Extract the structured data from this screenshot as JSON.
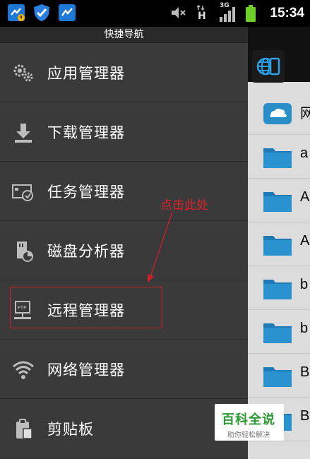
{
  "status_bar": {
    "time": "15:34",
    "network_label": "3G",
    "signal_label": "H"
  },
  "drawer": {
    "title": "快捷导航",
    "items": [
      {
        "label": "应用管理器",
        "icon": "gears-icon"
      },
      {
        "label": "下载管理器",
        "icon": "download-icon"
      },
      {
        "label": "任务管理器",
        "icon": "task-icon"
      },
      {
        "label": "磁盘分析器",
        "icon": "disk-analyze-icon"
      },
      {
        "label": "远程管理器",
        "icon": "ftp-icon"
      },
      {
        "label": "网络管理器",
        "icon": "wifi-icon"
      },
      {
        "label": "剪贴板",
        "icon": "clipboard-icon"
      }
    ]
  },
  "annotation": {
    "text": "点击此处"
  },
  "file_list": {
    "items": [
      {
        "name": "网",
        "icon": "cloud-drive-icon"
      },
      {
        "name": "a",
        "icon": "folder-icon"
      },
      {
        "name": "A",
        "icon": "folder-icon"
      },
      {
        "name": "A",
        "icon": "folder-icon"
      },
      {
        "name": "b",
        "icon": "folder-icon"
      },
      {
        "name": "b",
        "icon": "folder-icon"
      },
      {
        "name": "B",
        "icon": "folder-icon"
      },
      {
        "name": "B",
        "icon": "folder-icon"
      }
    ]
  },
  "watermark": {
    "title": "百科全说",
    "subtitle": "助你轻松解决"
  },
  "colors": {
    "drawer_bg": "#3a3a3a",
    "annotation_red": "#d0202a",
    "folder_blue": "#2a8fc8",
    "watermark_green": "#2a9a32"
  }
}
